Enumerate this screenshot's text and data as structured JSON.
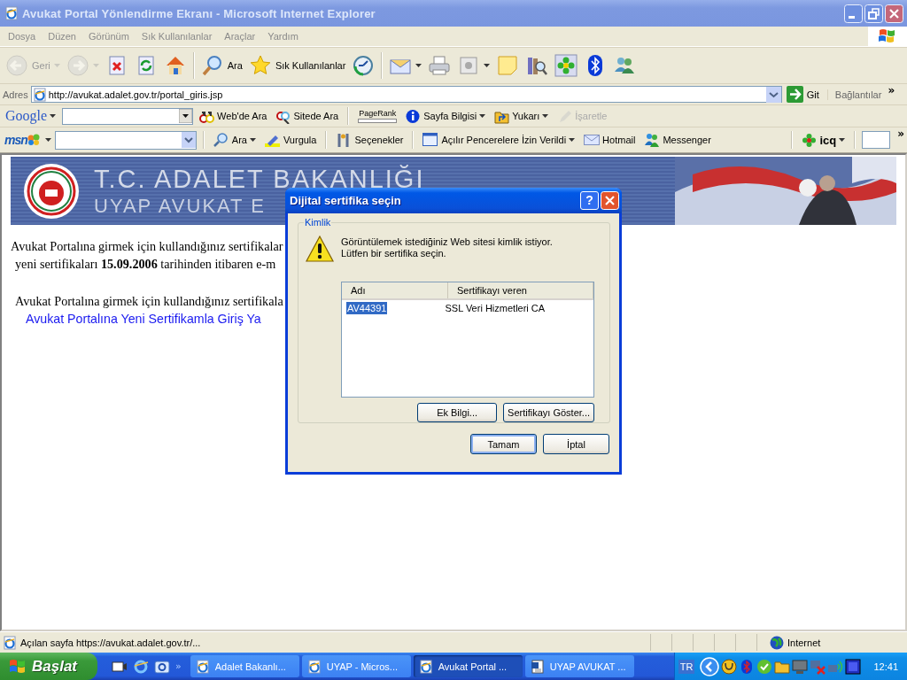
{
  "window": {
    "title": "Avukat Portal Yönlendirme Ekranı - Microsoft Internet Explorer"
  },
  "menu": [
    "Dosya",
    "Düzen",
    "Görünüm",
    "Sık Kullanılanlar",
    "Araçlar",
    "Yardım"
  ],
  "toolbar": [
    {
      "kind": "button",
      "label": "Geri",
      "dropdown": true,
      "disabled": true
    },
    {
      "kind": "button",
      "dropdown": true,
      "disabled": true
    },
    {
      "kind": "button",
      "disabled": false
    },
    {
      "kind": "button",
      "disabled": false
    },
    {
      "kind": "button",
      "disabled": false
    },
    {
      "kind": "separator"
    },
    {
      "kind": "button",
      "label": "Ara",
      "disabled": false
    },
    {
      "kind": "button",
      "label": "Sık Kullanılanlar",
      "disabled": false
    },
    {
      "kind": "button",
      "disabled": false
    },
    {
      "kind": "separator"
    },
    {
      "kind": "button",
      "dropdown": true,
      "disabled": false
    },
    {
      "kind": "button",
      "disabled": false
    },
    {
      "kind": "button",
      "dropdown": true,
      "disabled": false
    },
    {
      "kind": "button",
      "disabled": false
    },
    {
      "kind": "button",
      "disabled": false
    },
    {
      "kind": "button",
      "disabled": false
    },
    {
      "kind": "button",
      "disabled": false
    },
    {
      "kind": "button",
      "disabled": false
    }
  ],
  "address": {
    "label": "Adres",
    "url": "http://avukat.adalet.gov.tr/portal_giris.jsp",
    "go": "Git",
    "links": "Bağlantılar",
    "more": "»"
  },
  "google_bar": {
    "logo": "Google",
    "items": [
      {
        "label": "Web'de Ara",
        "disabled": false
      },
      {
        "label": "Sitede Ara",
        "disabled": false
      },
      {
        "label": "PageRank",
        "disabled": false
      },
      {
        "label": "Sayfa Bilgisi",
        "dropdown": true,
        "disabled": false
      },
      {
        "label": "Yukarı",
        "dropdown": true,
        "disabled": false
      },
      {
        "label": "İşaretle",
        "disabled": true
      }
    ]
  },
  "msn_bar": {
    "logo": "msn",
    "items": [
      {
        "label": "Ara",
        "dropdown": true
      },
      {
        "label": "Vurgula"
      },
      {
        "label": "Seçenekler"
      },
      {
        "label": "Açılır Pencerelere İzin Verildi",
        "dropdown": true
      },
      {
        "label": "Hotmail"
      },
      {
        "label": "Messenger"
      }
    ],
    "icq": "icq",
    "more": "»"
  },
  "banner": {
    "line_1": "T.C. ADALET BAKANLIĞI",
    "line_2": "UYAP AVUKAT E"
  },
  "page": {
    "paragraph_1": [
      "Avukat Portalına girmek için kullandığınız sertifikalar",
      "yeni sertifikaları **15.09.2006** tarihinden itibaren e-m"
    ],
    "paragraph_2": "Avukat Portalına girmek için kullandığınız sertifikala",
    "link": "Avukat Portalına Yeni Sertifikamla Giriş Ya"
  },
  "dialog": {
    "title": "Dijital sertifika seçin",
    "help": "?",
    "group": "Kimlik",
    "message": [
      "Görüntülemek istediğiniz Web sitesi kimlik istiyor.",
      "Lütfen bir sertifika seçin."
    ],
    "columns": [
      "Adı",
      "Sertifikayı veren"
    ],
    "rows": [
      {
        "cells": [
          "AV44391",
          "SSL Veri Hizmetleri CA"
        ],
        "selected": true
      }
    ],
    "list_buttons": [
      "Ek Bilgi...",
      "Sertifikayı Göster..."
    ],
    "buttons": [
      "Tamam",
      "İptal"
    ]
  },
  "status_bar": {
    "text": "Açılan sayfa https://avukat.adalet.gov.tr/...",
    "zone": "Internet"
  },
  "taskbar": {
    "start": "Başlat",
    "more": "»",
    "tasks": [
      {
        "label": "Adalet Bakanlı...",
        "selected": false,
        "kind": "browser"
      },
      {
        "label": "UYAP - Micros...",
        "selected": false,
        "kind": "browser"
      },
      {
        "label": "Avukat Portal ...",
        "selected": true,
        "kind": "browser"
      },
      {
        "label": "UYAP AVUKAT ...",
        "selected": false,
        "kind": "document"
      }
    ],
    "language": "TR",
    "clock": "12:41"
  }
}
